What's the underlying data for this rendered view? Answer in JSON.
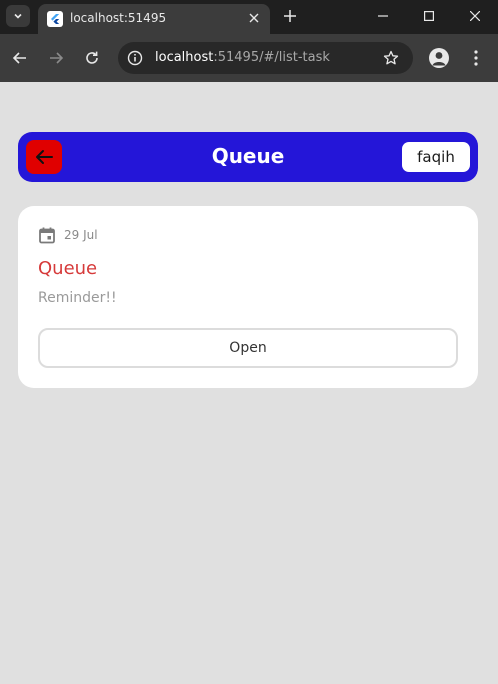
{
  "browser": {
    "tab": {
      "title": "localhost:51495"
    },
    "address_bar": {
      "host": "localhost",
      "path": ":51495/#/list-task"
    }
  },
  "app": {
    "header": {
      "title": "Queue",
      "user": "faqih"
    },
    "task_card": {
      "date": "29 Jul",
      "title": "Queue",
      "description": "Reminder!!",
      "action_label": "Open"
    }
  },
  "colors": {
    "appbar": "#2416d8",
    "back_button": "#e00000",
    "task_title": "#d63a3a",
    "background": "#e0e0e0"
  },
  "icons": {
    "back": "arrow-left-icon",
    "date": "calendar-icon"
  }
}
